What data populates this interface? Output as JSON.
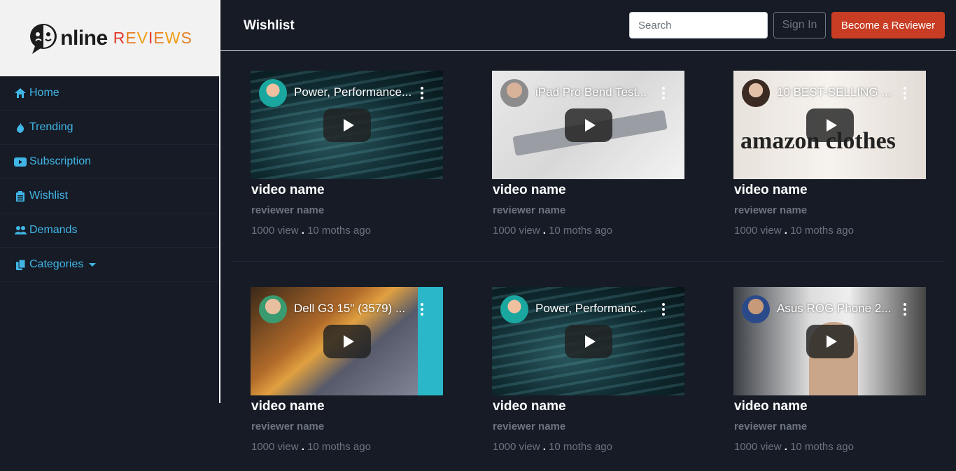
{
  "logo": {
    "word": "nline",
    "accent": "REVIEWS"
  },
  "sidebar": {
    "items": [
      {
        "label": "Home",
        "icon": "home-icon"
      },
      {
        "label": "Trending",
        "icon": "fire-icon"
      },
      {
        "label": "Subscription",
        "icon": "youtube-icon"
      },
      {
        "label": "Wishlist",
        "icon": "clipboard-icon"
      },
      {
        "label": "Demands",
        "icon": "users-icon"
      },
      {
        "label": "Categories",
        "icon": "copy-icon"
      }
    ]
  },
  "header": {
    "title": "Wishlist",
    "search_placeholder": "Search",
    "signin_label": "Sign In",
    "become_label": "Become a Reviewer"
  },
  "videos": [
    {
      "title": "Power, Performance...",
      "name": "video name",
      "reviewer": "reviewer name",
      "views": "1000 view",
      "sep": ".",
      "age": "10 moths ago"
    },
    {
      "title": "iPad Pro Bend Test...",
      "name": "video name",
      "reviewer": "reviewer name",
      "views": "1000 view",
      "sep": ".",
      "age": "10 moths ago"
    },
    {
      "title": "10 BEST-SELLING ...",
      "name": "video name",
      "reviewer": "reviewer name",
      "views": "1000 view",
      "sep": ".",
      "age": "10 moths ago",
      "overlay": "amazon clothes"
    },
    {
      "title": "Dell G3 15\" (3579) ...",
      "name": "video name",
      "reviewer": "reviewer name",
      "views": "1000 view",
      "sep": ".",
      "age": "10 moths ago"
    },
    {
      "title": "Power, Performanc...",
      "name": "video name",
      "reviewer": "reviewer name",
      "views": "1000 view",
      "sep": ".",
      "age": "10 moths ago"
    },
    {
      "title": "Asus ROG Phone 2...",
      "name": "video name",
      "reviewer": "reviewer name",
      "views": "1000 view",
      "sep": ".",
      "age": "10 moths ago"
    }
  ],
  "colors": {
    "accent": "#41b6e6",
    "brand": "#c83d24",
    "bg": "#161b26"
  }
}
